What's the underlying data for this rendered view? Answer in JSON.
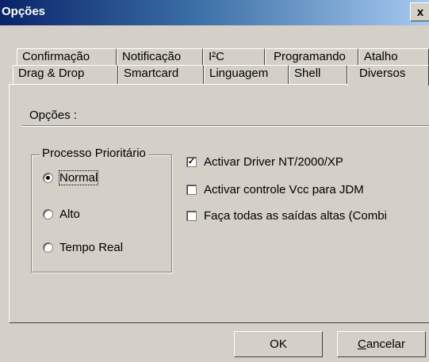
{
  "window": {
    "title": "Opções",
    "close_glyph": "x"
  },
  "tabs_row1": [
    {
      "label": "Confirmação"
    },
    {
      "label": "Notificação"
    },
    {
      "label": "I²C"
    },
    {
      "label": "Programando"
    },
    {
      "label": "Atalho"
    }
  ],
  "tabs_row2": [
    {
      "label": "Drag & Drop"
    },
    {
      "label": "Smartcard"
    },
    {
      "label": "Linguagem"
    },
    {
      "label": "Shell"
    },
    {
      "label": "Diversos",
      "active": true
    }
  ],
  "panel": {
    "section_label": "Opções :",
    "group": {
      "legend": "Processo Prioritário",
      "options": [
        {
          "label": "Normal",
          "selected": true
        },
        {
          "label": "Alto",
          "selected": false
        },
        {
          "label": "Tempo Real",
          "selected": false
        }
      ]
    },
    "checks": [
      {
        "label": "Activar Driver NT/2000/XP",
        "checked": true
      },
      {
        "label": "Activar controle Vcc para JDM",
        "checked": false
      },
      {
        "label": "Faça todas as saídas altas (Combi",
        "checked": false
      }
    ]
  },
  "buttons": {
    "ok": "OK",
    "cancel_first": "C",
    "cancel_rest": "ancelar"
  },
  "icons": {
    "radio": "radio-icon",
    "checkbox": "checkbox-icon",
    "close": "close-icon"
  }
}
